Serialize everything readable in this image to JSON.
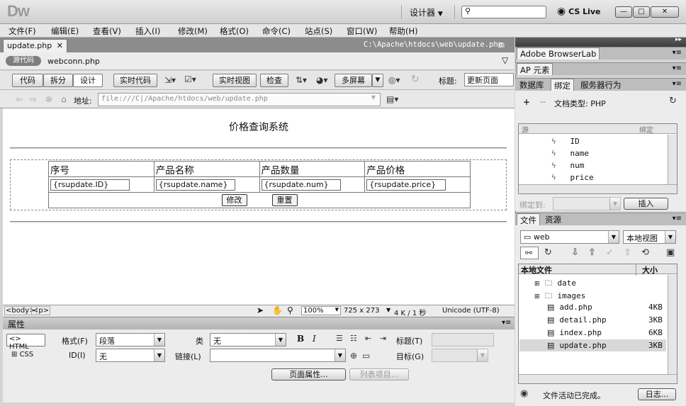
{
  "app": {
    "logo": "Dw",
    "workspace": "设计器",
    "cslive": "CS Live"
  },
  "menu": [
    "文件(F)",
    "编辑(E)",
    "查看(V)",
    "插入(I)",
    "修改(M)",
    "格式(O)",
    "命令(C)",
    "站点(S)",
    "窗口(W)",
    "帮助(H)"
  ],
  "document": {
    "tab": "update.php",
    "path": "C:\\Apache\\htdocs\\web\\update.php",
    "source_pill": "源代码",
    "related_file": "webconn.php"
  },
  "toolbar": {
    "code": "代码",
    "split": "拆分",
    "design": "设计",
    "live_code": "实时代码",
    "live_view": "实时视图",
    "inspect": "检查",
    "multiscreen": "多屏幕",
    "title_label": "标题:",
    "title_value": "更新页面"
  },
  "address": {
    "label": "地址:",
    "value": "file:///C|/Apache/htdocs/web/update.php"
  },
  "page": {
    "heading": "价格查询系统",
    "headers": [
      "序号",
      "产品名称",
      "产品数量",
      "产品价格"
    ],
    "fields": [
      "{rsupdate.ID}",
      "{rsupdate.name}",
      "{rsupdate.num}",
      "{rsupdate.price}"
    ],
    "submit": "修改",
    "reset": "重置"
  },
  "status": {
    "tags": [
      "<body>",
      "<p>"
    ],
    "zoom": "100%",
    "size": "725 x 273",
    "filesize": "4 K / 1 秒",
    "encoding": "Unicode (UTF-8)"
  },
  "properties": {
    "header": "属性",
    "html_btn": "HTML",
    "css_btn": "CSS",
    "format_label": "格式(F)",
    "format_value": "段落",
    "id_label": "ID(I)",
    "id_value": "无",
    "class_label": "类",
    "class_value": "无",
    "link_label": "链接(L)",
    "bold": "B",
    "italic": "I",
    "title_label": "标题(T)",
    "target_label": "目标(G)",
    "page_props": "页面属性...",
    "list_item": "列表项目..."
  },
  "panels": {
    "browserlab": "Adobe BrowserLab",
    "ap": "AP 元素",
    "tabs": [
      "数据库",
      "绑定",
      "服务器行为"
    ],
    "doc_type": "文档类型: PHP",
    "col_source": "源",
    "col_binding": "绑定",
    "bindings": [
      "ID",
      "name",
      "num",
      "price"
    ],
    "bind_to": "绑定到:",
    "insert": "插入",
    "file_tabs": [
      "文件",
      "资源"
    ],
    "site": "web",
    "view": "本地视图",
    "local_files": "本地文件",
    "size_col": "大小",
    "files": [
      {
        "name": "date",
        "size": "",
        "type": "folder"
      },
      {
        "name": "images",
        "size": "",
        "type": "folder"
      },
      {
        "name": "add.php",
        "size": "4KB",
        "type": "file"
      },
      {
        "name": "detail.php",
        "size": "3KB",
        "type": "file"
      },
      {
        "name": "index.php",
        "size": "6KB",
        "type": "file"
      },
      {
        "name": "update.php",
        "size": "3KB",
        "type": "file"
      }
    ],
    "status_msg": "文件活动已完成。",
    "log_btn": "日志..."
  }
}
